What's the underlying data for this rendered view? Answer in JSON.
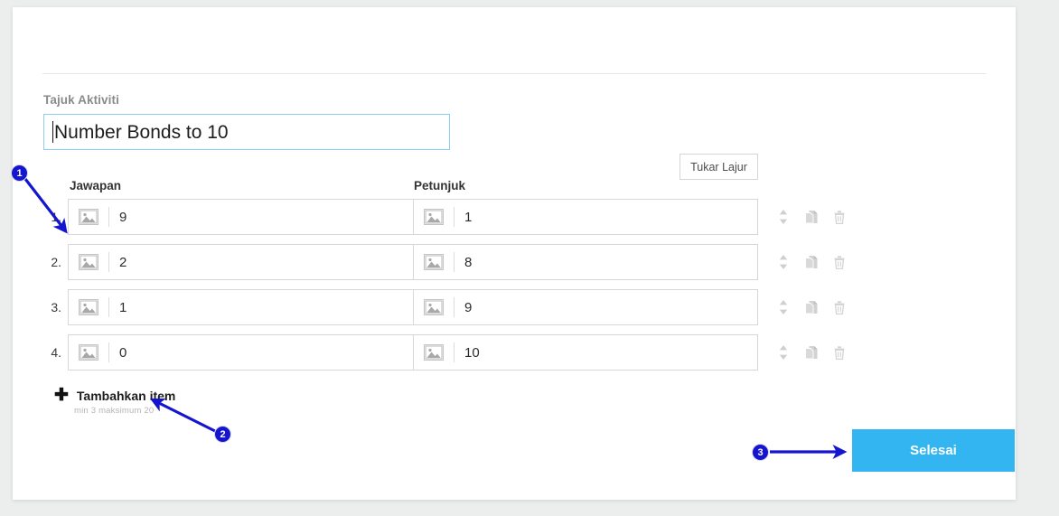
{
  "form": {
    "title_label": "Tajuk Aktiviti",
    "title_value": "Number Bonds to 10"
  },
  "toolbar": {
    "swap_columns_label": "Tukar Lajur"
  },
  "table": {
    "headers": {
      "answer": "Jawapan",
      "hint": "Petunjuk"
    },
    "rows": [
      {
        "index": "1.",
        "answer": "9",
        "hint": "1"
      },
      {
        "index": "2.",
        "answer": "2",
        "hint": "8"
      },
      {
        "index": "3.",
        "answer": "1",
        "hint": "9"
      },
      {
        "index": "4.",
        "answer": "0",
        "hint": "10"
      }
    ],
    "row_icons": {
      "reorder": "sort-vertical-icon",
      "duplicate": "duplicate-icon",
      "delete": "trash-icon"
    },
    "image_picker_icon": "image-placeholder-icon"
  },
  "add_item": {
    "icon": "plus-icon",
    "label": "Tambahkan item",
    "hint": "min 3 maksimum 20"
  },
  "submit": {
    "label": "Selesai"
  },
  "annotations": [
    {
      "number": "1"
    },
    {
      "number": "2"
    },
    {
      "number": "3"
    }
  ],
  "colors": {
    "accent": "#33b5f2",
    "annotation": "#1515cf",
    "input_focus_border": "#8dcdf0",
    "page_background": "#eceded"
  }
}
